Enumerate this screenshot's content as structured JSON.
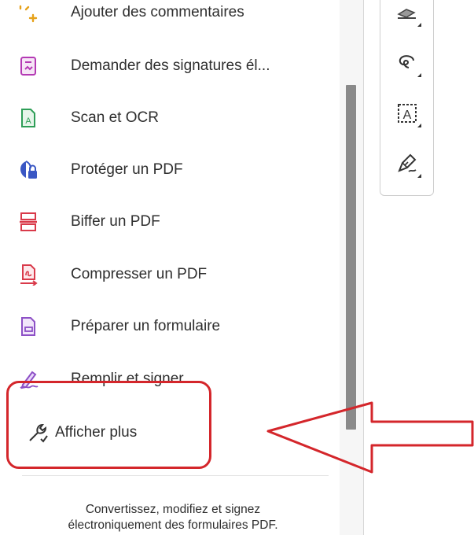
{
  "tools": [
    {
      "label": "Ajouter des commentaires",
      "icon": "add-comment-icon"
    },
    {
      "label": "Demander des signatures él...",
      "icon": "request-signature-icon"
    },
    {
      "label": "Scan et OCR",
      "icon": "scan-ocr-icon"
    },
    {
      "label": "Protéger un PDF",
      "icon": "protect-pdf-icon"
    },
    {
      "label": "Biffer un PDF",
      "icon": "redact-pdf-icon"
    },
    {
      "label": "Compresser un PDF",
      "icon": "compress-pdf-icon"
    },
    {
      "label": "Préparer un formulaire",
      "icon": "prepare-form-icon"
    },
    {
      "label": "Remplir et signer",
      "icon": "fill-sign-icon"
    },
    {
      "label": "Afficher plus",
      "icon": "wrench-icon"
    }
  ],
  "footer": {
    "line1": "Convertissez, modifiez et signez",
    "line2": "électroniquement des formulaires PDF."
  },
  "right_toolbar": [
    "highlight-icon",
    "lasso-icon",
    "text-box-icon",
    "sign-pen-icon"
  ],
  "annotation": {
    "color": "#d4262b"
  },
  "colors": {
    "purple": "#b43ab4",
    "green": "#2e9e57",
    "blue": "#3a57c4",
    "red": "#d93a4a",
    "violet": "#8d50c6"
  }
}
